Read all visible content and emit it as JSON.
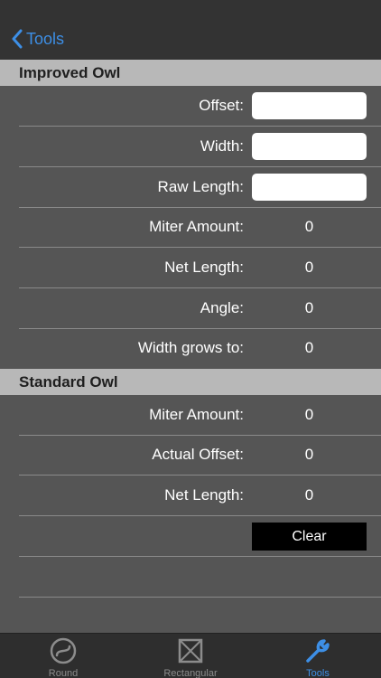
{
  "nav": {
    "back_label": "Tools"
  },
  "improved": {
    "title": "Improved Owl",
    "offset_label": "Offset:",
    "offset_value": "",
    "width_label": "Width:",
    "width_value": "",
    "raw_length_label": "Raw Length:",
    "raw_length_value": "",
    "miter_label": "Miter Amount:",
    "miter_value": "0",
    "net_length_label": "Net Length:",
    "net_length_value": "0",
    "angle_label": "Angle:",
    "angle_value": "0",
    "width_grows_label": "Width grows to:",
    "width_grows_value": "0"
  },
  "standard": {
    "title": "Standard Owl",
    "miter_label": "Miter Amount:",
    "miter_value": "0",
    "actual_offset_label": "Actual Offset:",
    "actual_offset_value": "0",
    "net_length_label": "Net Length:",
    "net_length_value": "0"
  },
  "clear_label": "Clear",
  "tabs": [
    {
      "label": "Round",
      "icon": "round-icon"
    },
    {
      "label": "Rectangular",
      "icon": "rectangular-icon"
    },
    {
      "label": "Tools",
      "icon": "wrench-icon"
    }
  ],
  "colors": {
    "accent": "#3d8fe6",
    "background": "#555555",
    "header": "#b8b8b8",
    "navbar": "#333333"
  }
}
